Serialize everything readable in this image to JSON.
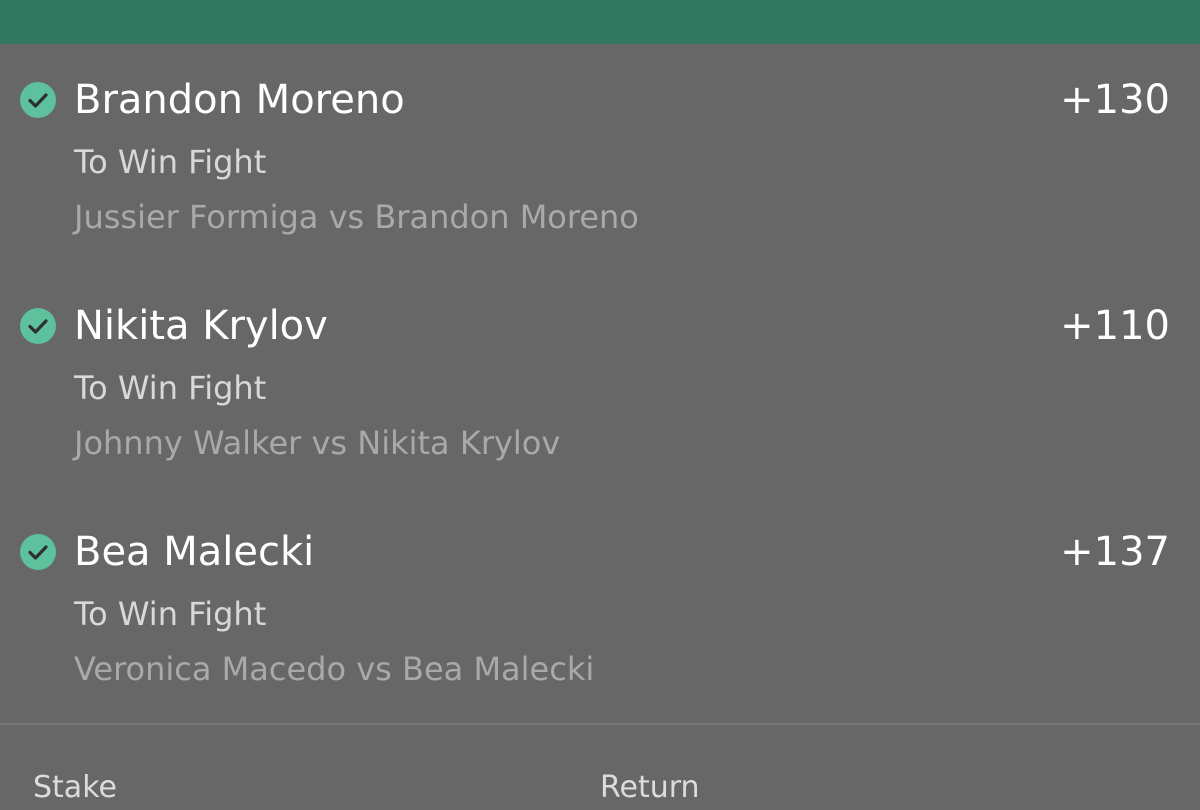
{
  "selections": [
    {
      "name": "Brandon Moreno",
      "odds": "+130",
      "market": "To Win Fight",
      "event": "Jussier Formiga vs Brandon Moreno",
      "settled_icon": "check-circle-icon"
    },
    {
      "name": "Nikita Krylov",
      "odds": "+110",
      "market": "To Win Fight",
      "event": "Johnny Walker vs Nikita Krylov",
      "settled_icon": "check-circle-icon"
    },
    {
      "name": "Bea Malecki",
      "odds": "+137",
      "market": "To Win Fight",
      "event": "Veronica Macedo vs Bea Malecki",
      "settled_icon": "check-circle-icon"
    }
  ],
  "footer": {
    "stake_label": "Stake",
    "return_label": "Return"
  },
  "colors": {
    "header": "#327760",
    "background": "#676767",
    "check": "#5cc19c"
  }
}
